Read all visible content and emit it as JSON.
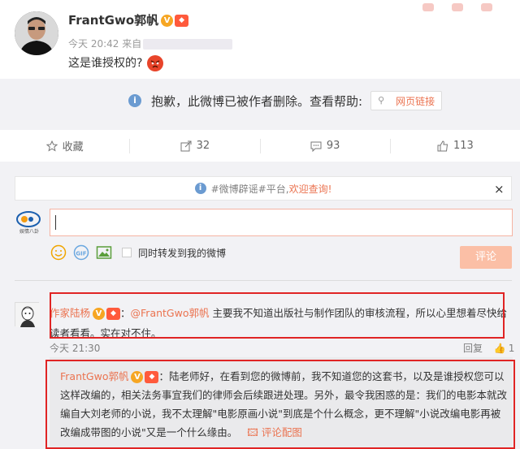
{
  "post": {
    "author": "FrantGwo郭帆",
    "time": "今天 20:42 来自",
    "text": "这是谁授权的?"
  },
  "deleted": {
    "message": "抱歉，此微博已被作者删除。查看帮助:",
    "link_label": "网页链接"
  },
  "actions": {
    "fav": "收藏",
    "repost": "32",
    "comment": "93",
    "like": "113"
  },
  "tip": {
    "prefix": "#微博辟谣#平台,",
    "highlight": "欢迎查询!",
    "close": "×"
  },
  "composer": {
    "forward_label": "同时转发到我的微博",
    "submit_label": "评论",
    "avatar_label": "娱情八卦"
  },
  "comment1": {
    "name": "作家陆杨",
    "at": "@FrantGwo郭帆",
    "text": "主要我不知道出版社与制作团队的审核流程，所以心里想着尽快给读者看看。实在对不住。",
    "time": "今天 21:30",
    "report": "回复",
    "likes": "1"
  },
  "reply": {
    "name": "FrantGwo郭帆",
    "text": "陆老师好，在看到您的微博前，我不知道您的这套书，以及是谁授权您可以这样改编的，相关法务事宜我们的律师会后续跟进处理。另外，最令我困惑的是：我们的电影本就改编自大刘老师的小说，我不太理解\"电影原画小说\"到底是个什么概念，更不理解\"小说改编电影再被改编成带图的小说\"又是一个什么缘由。",
    "pic_label": "评论配图"
  }
}
